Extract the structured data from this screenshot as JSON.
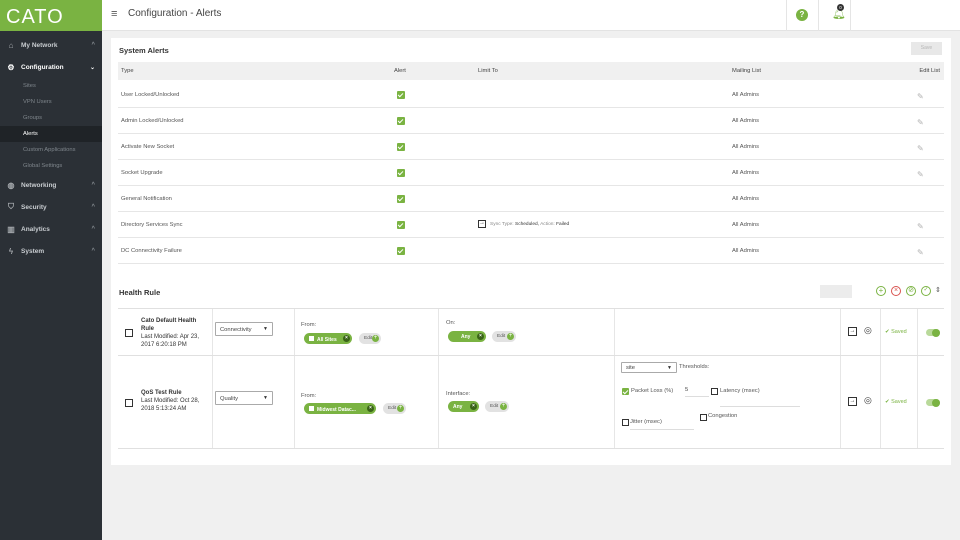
{
  "app": {
    "logo": "CATO",
    "menu_icon": "hamburger-icon"
  },
  "header": {
    "title": "Configuration - Alerts",
    "notifications_count": "0",
    "help_label": "?"
  },
  "sidebar": {
    "items": [
      {
        "label": "My Network",
        "icon": "home-icon"
      },
      {
        "label": "Configuration",
        "icon": "gear-icon"
      },
      {
        "label": "Networking",
        "icon": "globe-icon"
      },
      {
        "label": "Security",
        "icon": "shield-icon"
      },
      {
        "label": "Analytics",
        "icon": "chart-icon"
      },
      {
        "label": "System",
        "icon": "lightning-icon"
      }
    ],
    "sub_items": [
      "Sites",
      "VPN Users",
      "Groups",
      "Alerts",
      "Custom Applications",
      "Global Settings"
    ]
  },
  "system_alerts": {
    "title": "System Alerts",
    "save_label": "Save",
    "columns": [
      "Type",
      "Alert",
      "Limit To",
      "Mailing List",
      "Edit List"
    ],
    "rows": [
      {
        "type": "User Locked/Unlocked",
        "alert": true,
        "limit": "",
        "mailing": "All Admins",
        "editable": true
      },
      {
        "type": "Admin Locked/Unlocked",
        "alert": true,
        "limit": "",
        "mailing": "All Admins",
        "editable": true
      },
      {
        "type": "Activate New Socket",
        "alert": true,
        "limit": "",
        "mailing": "All Admins",
        "editable": true
      },
      {
        "type": "Socket Upgrade",
        "alert": true,
        "limit": "",
        "mailing": "All Admins",
        "editable": true
      },
      {
        "type": "General Notification",
        "alert": true,
        "limit": "",
        "mailing": "All Admins",
        "editable": false
      },
      {
        "type": "Directory Services Sync",
        "alert": true,
        "limit": "sync",
        "mailing": "All Admins",
        "editable": true
      },
      {
        "type": "DC Connectivity Failure",
        "alert": true,
        "limit": "",
        "mailing": "All Admins",
        "editable": true
      }
    ],
    "sync_limit": {
      "sync_type_label": "Sync Type:",
      "sync_type": "Scheduled,",
      "action_label": "Action:",
      "action": "Failed"
    }
  },
  "health_rule": {
    "title": "Health Rule",
    "rules": [
      {
        "name": "Cato Default Health Rule",
        "modified": "Last Modified: Apr 23, 2017 6:20:18 PM",
        "type": "Connectivity",
        "from_label": "From:",
        "from_value": "All Sites",
        "target_label": "On:",
        "target_value": "Any",
        "edit_label": "Edit",
        "status": "Saved"
      },
      {
        "name": "QoS Test Rule",
        "modified": "Last Modified: Oct 28, 2018 5:13:24 AM",
        "type": "Quality",
        "from_label": "From:",
        "from_value": "Midwest Datac...",
        "target_label": "Interface:",
        "target_value": "Any",
        "edit_label": "Edit",
        "status": "Saved",
        "thresholds": {
          "scope": "site",
          "label": "Thresholds:",
          "packet_loss_label": "Packet Loss (%)",
          "packet_loss_value": "5",
          "latency_label": "Latency (msec)",
          "jitter_label": "Jitter (msec)",
          "congestion_label": "Congestion"
        }
      }
    ]
  },
  "colors": {
    "accent": "#7ab342",
    "sidebar": "#2b3036"
  }
}
